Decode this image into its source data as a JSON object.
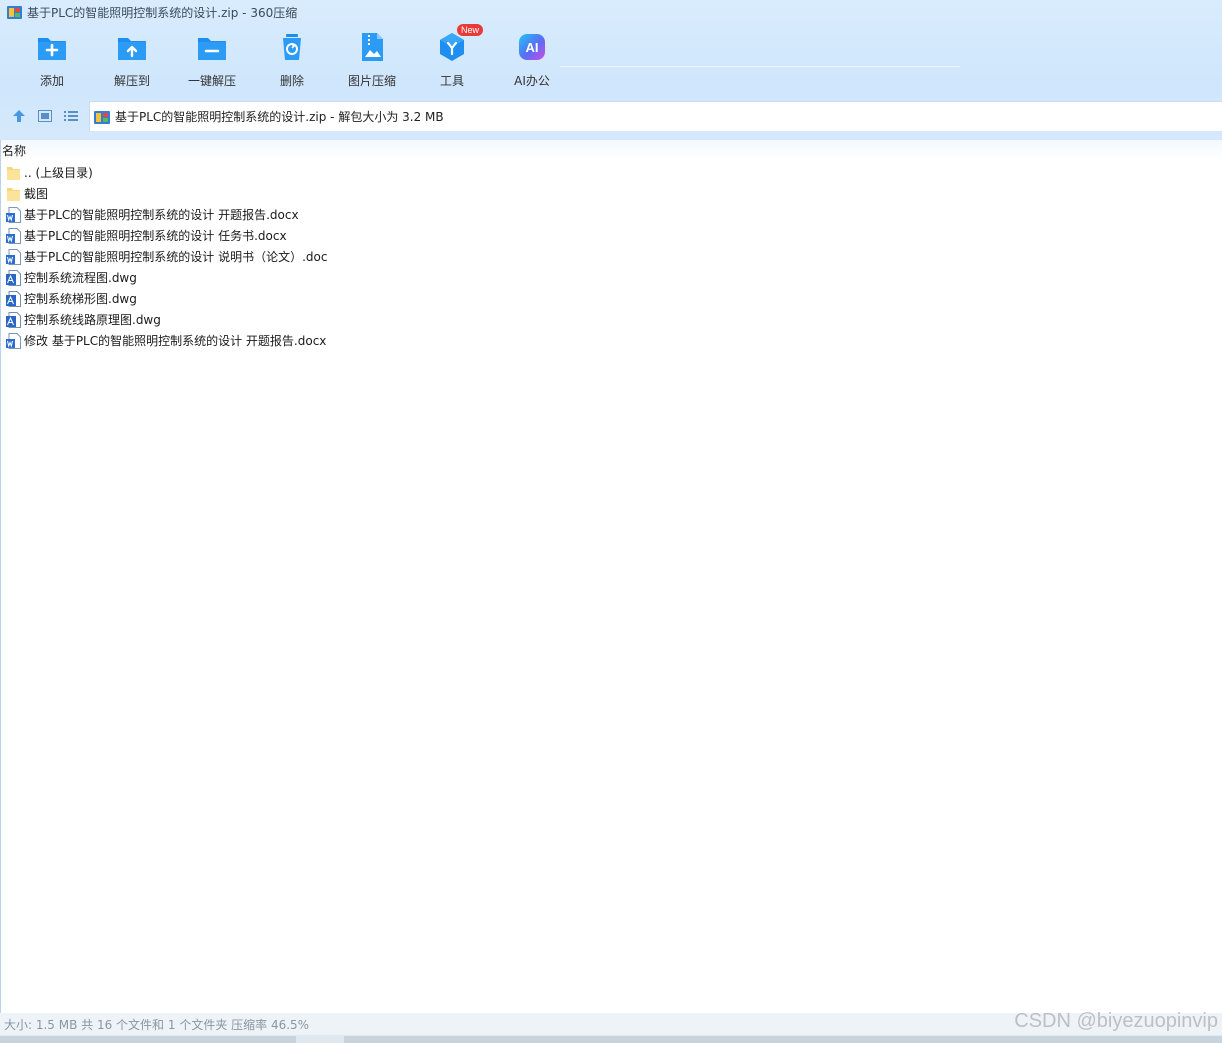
{
  "window": {
    "title": "基于PLC的智能照明控制系统的设计.zip - 360压缩"
  },
  "toolbar": {
    "items": [
      {
        "label": "添加",
        "icon": "add-icon"
      },
      {
        "label": "解压到",
        "icon": "extract-to-icon"
      },
      {
        "label": "一键解压",
        "icon": "one-click-extract-icon"
      },
      {
        "label": "删除",
        "icon": "delete-icon"
      },
      {
        "label": "图片压缩",
        "icon": "image-compress-icon"
      },
      {
        "label": "工具",
        "icon": "tools-icon",
        "badge": "New"
      },
      {
        "label": "AI办公",
        "icon": "ai-office-icon",
        "icon_text": "AI"
      }
    ],
    "accent_color": "#1e8ff0",
    "badge_color": "#e93a3a"
  },
  "address": {
    "text": "基于PLC的智能照明控制系统的设计.zip - 解包大小为 3.2 MB"
  },
  "list": {
    "column_name": "名称",
    "rows": [
      {
        "name": ".. (上级目录)",
        "type": "folder"
      },
      {
        "name": "截图",
        "type": "folder"
      },
      {
        "name": "基于PLC的智能照明控制系统的设计 开题报告.docx",
        "type": "word"
      },
      {
        "name": "基于PLC的智能照明控制系统的设计 任务书.docx",
        "type": "word"
      },
      {
        "name": "基于PLC的智能照明控制系统的设计 说明书（论文）.doc",
        "type": "word"
      },
      {
        "name": "控制系统流程图.dwg",
        "type": "dwg"
      },
      {
        "name": "控制系统梯形图.dwg",
        "type": "dwg"
      },
      {
        "name": "控制系统线路原理图.dwg",
        "type": "dwg"
      },
      {
        "name": "修改 基于PLC的智能照明控制系统的设计 开题报告.docx",
        "type": "word"
      }
    ]
  },
  "status": {
    "text": "大小: 1.5 MB 共 16 个文件和 1 个文件夹 压缩率 46.5%"
  },
  "watermark": {
    "text": "CSDN @biyezuopinvip"
  }
}
